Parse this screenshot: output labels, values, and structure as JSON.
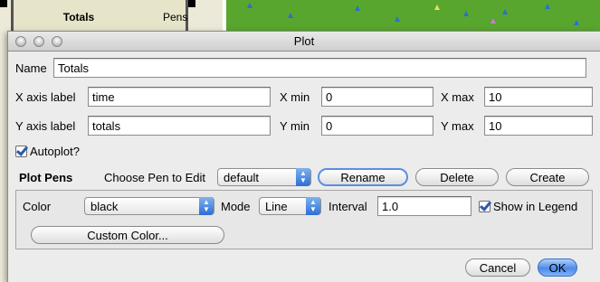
{
  "background": {
    "plot_title": "Totals",
    "plot_legend": "Pens"
  },
  "dialog": {
    "title": "Plot",
    "name_label": "Name",
    "name_value": "Totals",
    "x_axis_label": "X axis label",
    "x_axis_value": "time",
    "x_min_label": "X min",
    "x_min_value": "0",
    "x_max_label": "X max",
    "x_max_value": "10",
    "y_axis_label": "Y axis label",
    "y_axis_value": "totals",
    "y_min_label": "Y min",
    "y_min_value": "0",
    "y_max_label": "Y max",
    "y_max_value": "10",
    "autoplot_label": "Autoplot?",
    "autoplot_checked": true,
    "plot_pens_label": "Plot Pens",
    "choose_pen_label": "Choose Pen to Edit",
    "pen_selected": "default",
    "rename_label": "Rename",
    "delete_label": "Delete",
    "create_label": "Create",
    "color_label": "Color",
    "color_selected": "black",
    "mode_label": "Mode",
    "mode_selected": "Line",
    "interval_label": "Interval",
    "interval_value": "1.0",
    "show_legend_label": "Show in Legend",
    "show_legend_checked": true,
    "custom_color_label": "Custom Color...",
    "cancel_label": "Cancel",
    "ok_label": "OK"
  },
  "colors": {
    "world_green": "#58a62d",
    "accent_blue": "#4d8ae8"
  }
}
